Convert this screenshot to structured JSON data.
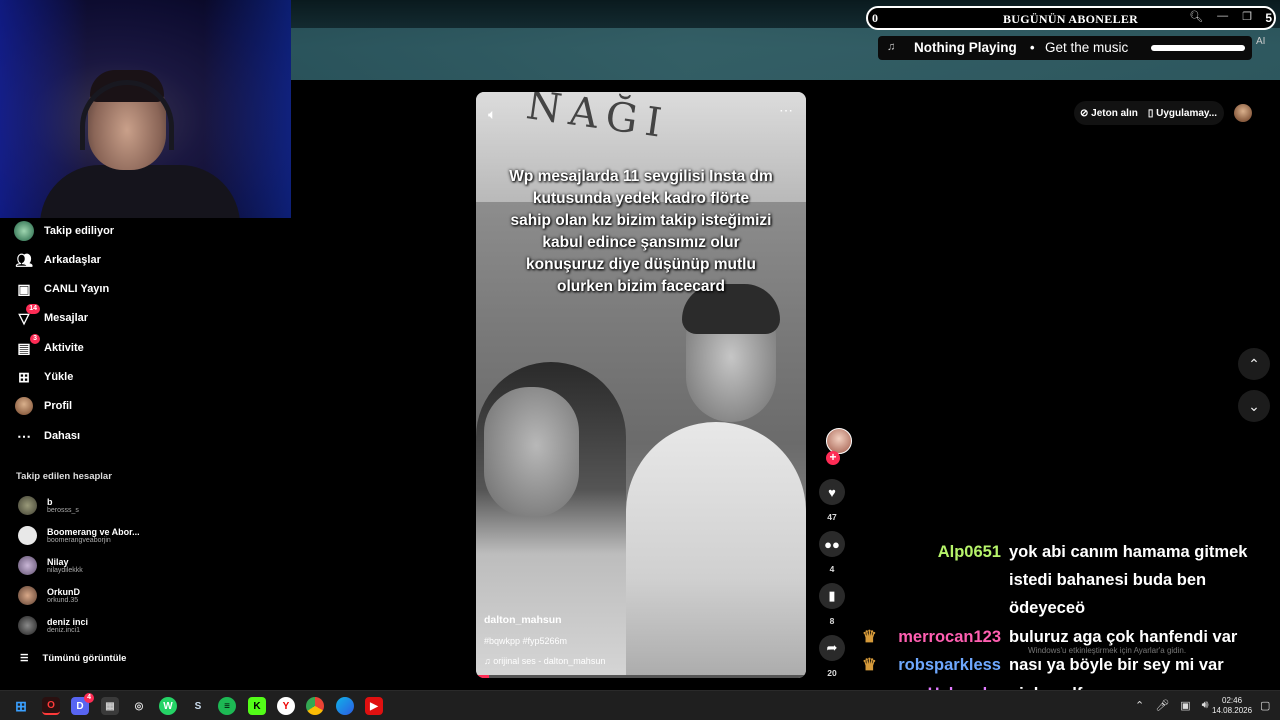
{
  "overlay": {
    "subs_count": "0",
    "subs_title": "BUGÜNÜN ABONELER",
    "subs_right": "5",
    "music_title": "Nothing Playing",
    "music_sub": "Get the music",
    "music_progress": 1.0,
    "ai_label": "AI"
  },
  "header": {
    "coins_label": "Jeton alın",
    "app_label": "Uygulamay..."
  },
  "sidebar": {
    "items": [
      {
        "label": "Takip ediliyor",
        "icon": "following-avatar-icon",
        "badge": ""
      },
      {
        "label": "Arkadaşlar",
        "icon": "friends-icon",
        "badge": ""
      },
      {
        "label": "CANLI Yayın",
        "icon": "live-icon",
        "badge": ""
      },
      {
        "label": "Mesajlar",
        "icon": "messages-icon",
        "badge": "14"
      },
      {
        "label": "Aktivite",
        "icon": "activity-icon",
        "badge": "3"
      },
      {
        "label": "Yükle",
        "icon": "upload-icon",
        "badge": ""
      },
      {
        "label": "Profil",
        "icon": "profile-icon",
        "badge": ""
      },
      {
        "label": "Dahası",
        "icon": "more-icon",
        "badge": ""
      }
    ],
    "following_title": "Takip edilen hesaplar",
    "accounts": [
      {
        "name": "b",
        "handle": "berosss_s"
      },
      {
        "name": "Boomerang ve Abor...",
        "handle": "boomerangveaborjin"
      },
      {
        "name": "Nilay",
        "handle": "nilaydilekkk"
      },
      {
        "name": "OrkunD",
        "handle": "orkund.35"
      },
      {
        "name": "deniz inci",
        "handle": "deniz.inci1"
      }
    ],
    "see_all": "Tümünü görüntüle"
  },
  "video": {
    "caption_lines": [
      "Wp mesajlarda 11 sevgilisi Insta dm",
      "kutusunda  yedek kadro flörte",
      "sahip olan kız bizim takip isteğimizi",
      "kabul edince şansımız olur",
      "konuşuruz diye düşünüp mutlu",
      "olurken bizim facecard"
    ],
    "sign_text": "NAĞI",
    "author": "dalton_mahsun",
    "tags": "#bqwkpp #fyp5266m",
    "sound": "orijinal ses - dalton_mahsun",
    "progress": 0.04
  },
  "rail": {
    "likes": "47",
    "comments": "4",
    "saves": "8",
    "shares": "20"
  },
  "chat": [
    {
      "user": "Alp0651",
      "user_color": "#b6f36a",
      "badge": "",
      "lines": [
        "yok abi canım hamama gitmek",
        "istedi bahanesi buda ben",
        "ödeyeceö"
      ]
    },
    {
      "user": "merrocan123",
      "user_color": "#ff5fb1",
      "badge": "crown",
      "lines": [
        "buluruz aga çok hanfendi var"
      ]
    },
    {
      "user": "robsparkless",
      "user_color": "#6ea8ff",
      "badge": "crown",
      "lines": [
        "nası ya böyle bir sey mi var"
      ]
    },
    {
      "user": "Helenoks",
      "user_color": "#e27bff",
      "badge": "",
      "lines": [
        "ojqbnwdfı"
      ]
    }
  ],
  "windows_activate": "Windows'u etkinleştirmek için Ayarlar'a gidin.",
  "taskbar": {
    "time": "02:46",
    "date": "14.08.2026",
    "discord_badge": "4"
  },
  "colors": {
    "accent": "#fe2c55",
    "background": "#000000"
  }
}
